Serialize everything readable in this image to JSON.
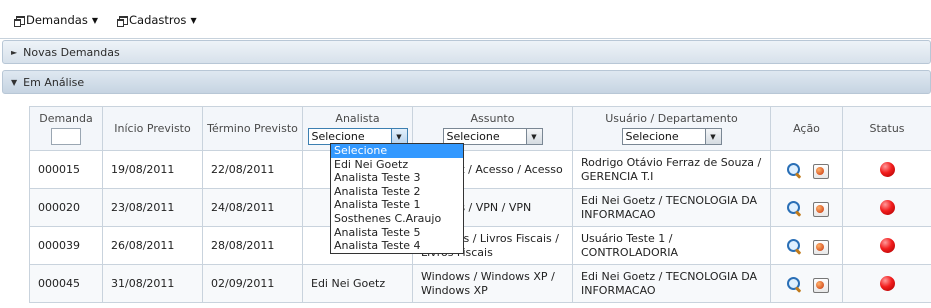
{
  "menu": {
    "items": [
      {
        "label": "Demandas"
      },
      {
        "label": "Cadastros"
      }
    ]
  },
  "panels": {
    "novas": {
      "label": "Novas Demandas"
    },
    "analise": {
      "label": "Em Análise"
    }
  },
  "grid": {
    "headers": {
      "demanda": "Demanda",
      "inicio": "Início Previsto",
      "termino": "Término Previsto",
      "analista": "Analista",
      "assunto": "Assunto",
      "usuario": "Usuário / Departamento",
      "acao": "Ação",
      "status": "Status"
    },
    "filters": {
      "analista": "Selecione",
      "assunto": "Selecione",
      "usuario": "Selecione"
    },
    "rows": [
      {
        "demanda": "000015",
        "inicio": "19/08/2011",
        "termino": "22/08/2011",
        "analista": "",
        "assunto": "Internet / Acesso / Acesso",
        "usuario": "Rodrigo Otávio Ferraz de Souza / GERENCIA T.I"
      },
      {
        "demanda": "000020",
        "inicio": "23/08/2011",
        "termino": "24/08/2011",
        "analista": "",
        "assunto": "Projetos / VPN / VPN",
        "usuario": "Edi Nei Goetz / TECNOLOGIA DA INFORMACAO"
      },
      {
        "demanda": "000039",
        "inicio": "26/08/2011",
        "termino": "28/08/2011",
        "analista": "",
        "assunto": "Protheus / Livros Fiscais / Livros Fiscais",
        "usuario": "Usuário Teste 1 / CONTROLADORIA"
      },
      {
        "demanda": "000045",
        "inicio": "31/08/2011",
        "termino": "02/09/2011",
        "analista": "Edi Nei Goetz",
        "assunto": "Windows / Windows XP / Windows XP",
        "usuario": "Edi Nei Goetz / TECNOLOGIA DA INFORMACAO"
      }
    ]
  },
  "analista_dropdown": {
    "options": [
      "Selecione",
      "Edi Nei Goetz",
      "Analista Teste 3",
      "Analista Teste 2",
      "Analista Teste 1",
      "Sosthenes C.Araujo",
      "Analista Teste 5",
      "Analista Teste 4"
    ],
    "selected_index": 0
  },
  "colors": {
    "panel_header": "#d7e1eb",
    "selected_option": "#3399ff",
    "status_red": "#f21d1d"
  },
  "icons": {
    "view": "magnifier-icon",
    "edit": "tools-icon",
    "status": "red-status-icon"
  }
}
